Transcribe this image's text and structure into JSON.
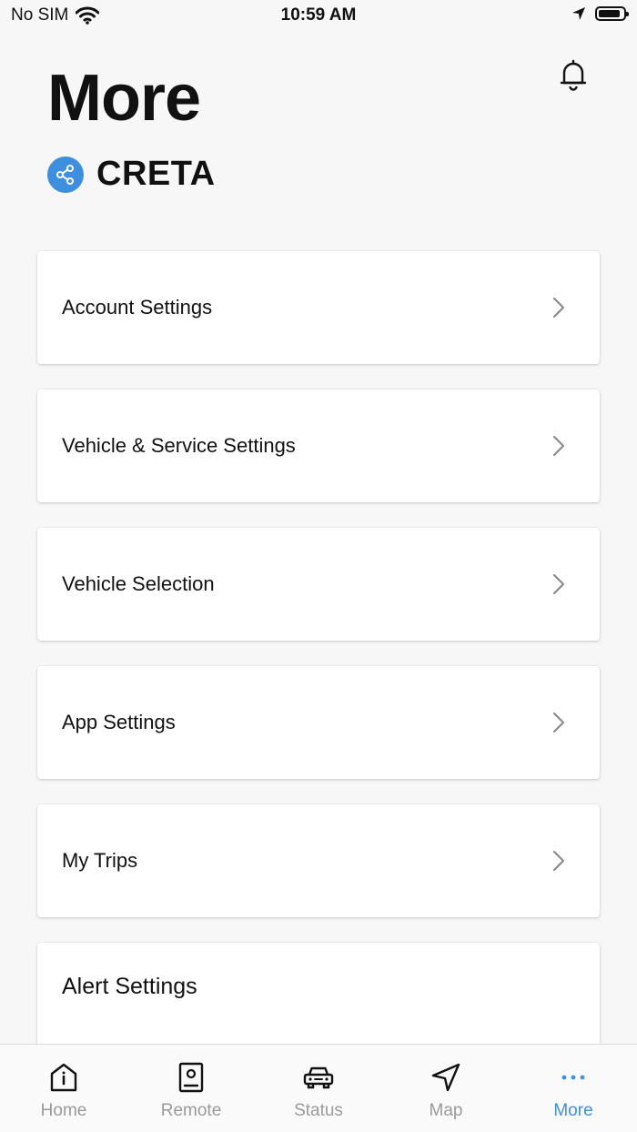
{
  "status_bar": {
    "carrier": "No SIM",
    "time": "10:59 AM",
    "battery_level": 0.9
  },
  "header": {
    "title": "More",
    "vehicle_name": "CRETA"
  },
  "menu": [
    {
      "label": "Account Settings"
    },
    {
      "label": "Vehicle & Service Settings"
    },
    {
      "label": "Vehicle Selection"
    },
    {
      "label": "App Settings"
    },
    {
      "label": "My Trips"
    },
    {
      "label": "Alert Settings"
    }
  ],
  "tabs": [
    {
      "label": "Home",
      "icon": "home-icon"
    },
    {
      "label": "Remote",
      "icon": "remote-icon"
    },
    {
      "label": "Status",
      "icon": "car-icon"
    },
    {
      "label": "Map",
      "icon": "navigation-arrow-icon"
    },
    {
      "label": "More",
      "icon": "ellipsis-icon",
      "active": true
    }
  ],
  "colors": {
    "accent": "#3f8fe0",
    "inactive_tab": "#9a9a9a",
    "background": "#f7f7f7"
  }
}
